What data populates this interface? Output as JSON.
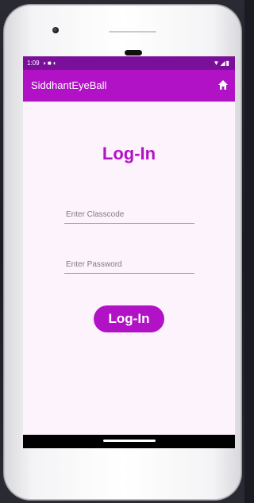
{
  "status_bar": {
    "time": "1:09",
    "left_icons": [
      "vpn-icon",
      "sim-icon",
      "data-saver-icon"
    ],
    "right_icons": [
      "wifi-icon",
      "signal-icon",
      "battery-icon"
    ]
  },
  "app_bar": {
    "title": "SiddhantEyeBall",
    "home_icon": "home-icon"
  },
  "login": {
    "heading": "Log-In",
    "classcode_placeholder": "Enter Classcode",
    "password_placeholder": "Enter Password",
    "button_label": "Log-In"
  },
  "colors": {
    "accent": "#b212c6",
    "status_bar": "#7a0f99",
    "background": "#fdf3fc"
  }
}
